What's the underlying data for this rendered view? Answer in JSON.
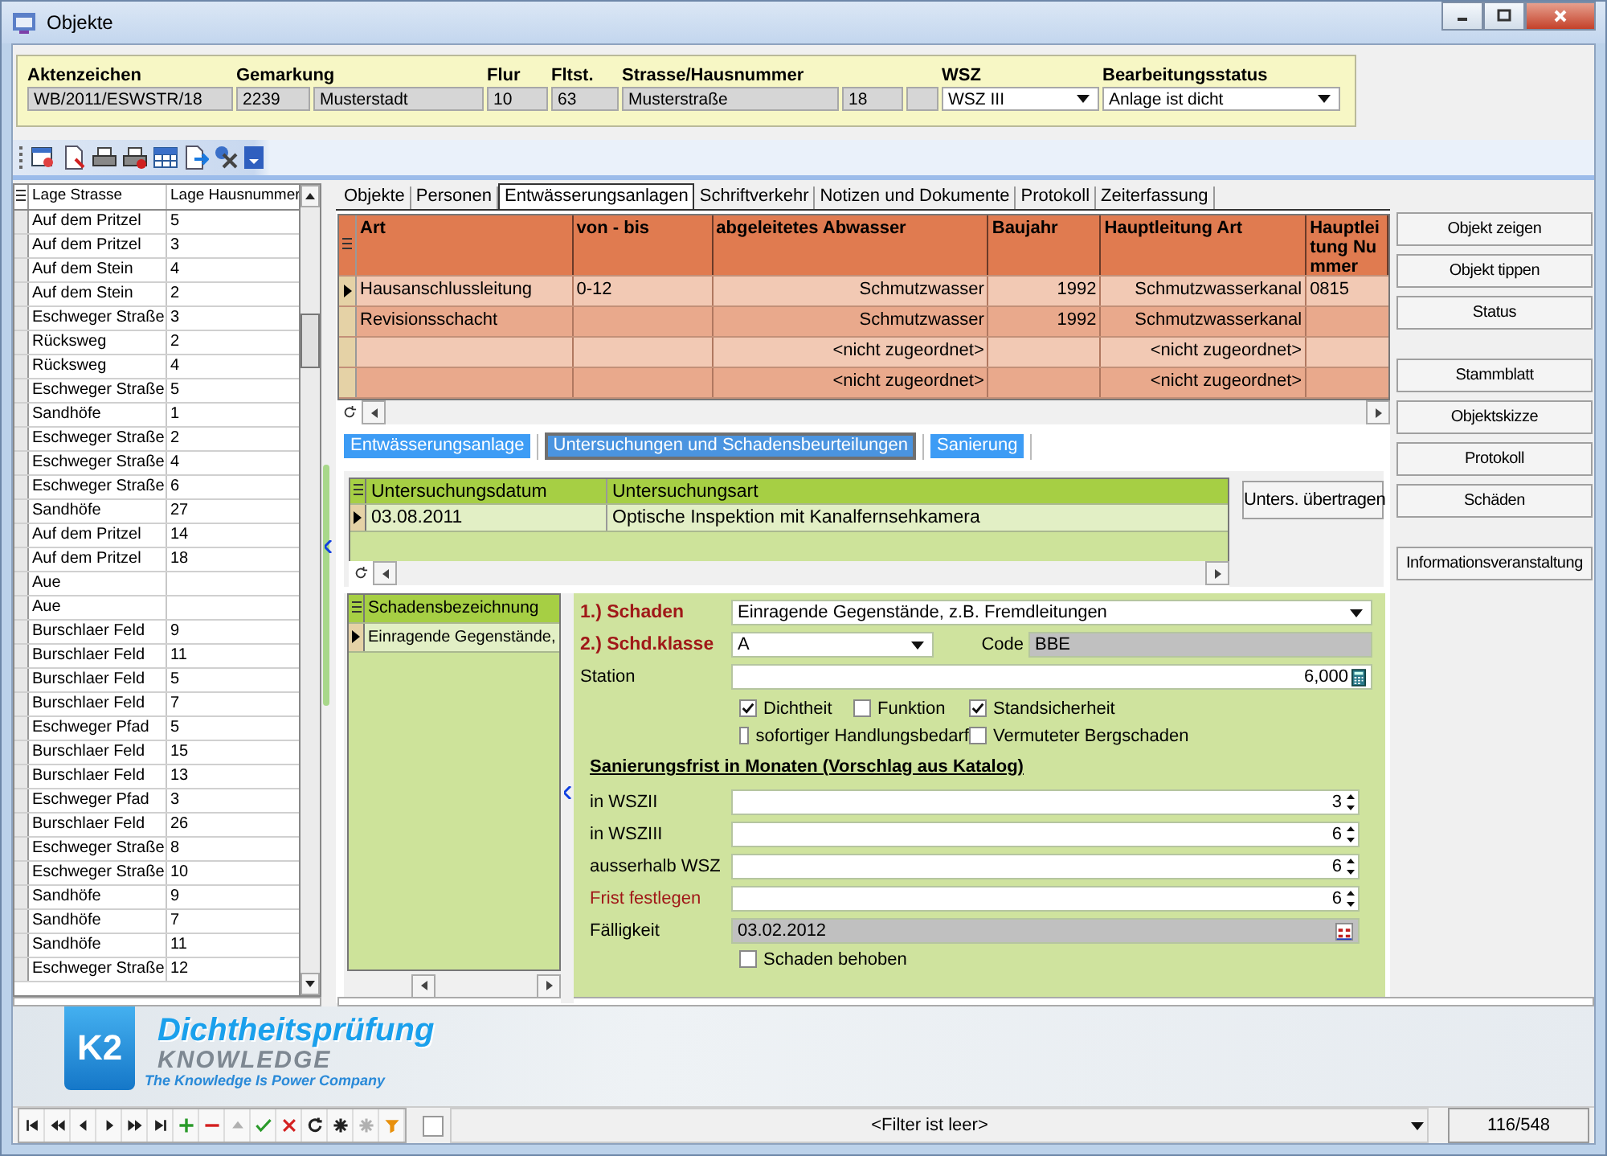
{
  "window": {
    "title": "Objekte"
  },
  "header": {
    "groups": [
      {
        "label": "Aktenzeichen",
        "fields": [
          {
            "kind": "text",
            "value": "WB/2011/ESWSTR/18"
          }
        ]
      },
      {
        "label": "Gemarkung",
        "fields": [
          {
            "kind": "text",
            "value": "2239"
          },
          {
            "kind": "text",
            "value": "Musterstadt"
          }
        ]
      },
      {
        "label": "Flur",
        "fields": [
          {
            "kind": "text",
            "value": "10"
          }
        ]
      },
      {
        "label": "Fltst.",
        "fields": [
          {
            "kind": "text",
            "value": "63"
          }
        ]
      },
      {
        "label": "Strasse/Hausnummer",
        "fields": [
          {
            "kind": "text",
            "value": "Musterstraße"
          },
          {
            "kind": "text",
            "value": "18"
          },
          {
            "kind": "text"
          }
        ]
      },
      {
        "label": "WSZ",
        "fields": [
          {
            "kind": "select",
            "value": "WSZ III"
          }
        ]
      },
      {
        "label": "Bearbeitungsstatus",
        "fields": [
          {
            "kind": "select",
            "value": "Anlage ist dicht"
          }
        ]
      }
    ]
  },
  "object_list": {
    "columns": [
      "Lage Strasse",
      "Lage Hausnummer"
    ],
    "rows": [
      {
        "street": "Auf dem Pritzel",
        "number": "5"
      },
      {
        "street": "Auf dem Pritzel",
        "number": "3"
      },
      {
        "street": "Auf dem Stein",
        "number": "4"
      },
      {
        "street": "Auf dem Stein",
        "number": "2"
      },
      {
        "street": "Eschweger Straße",
        "number": "3"
      },
      {
        "street": "Rücksweg",
        "number": "2"
      },
      {
        "street": "Rücksweg",
        "number": "4"
      },
      {
        "street": "Eschweger Straße",
        "number": "5"
      },
      {
        "street": "Sandhöfe",
        "number": "1"
      },
      {
        "street": "Eschweger Straße",
        "number": "2"
      },
      {
        "street": "Eschweger Straße",
        "number": "4"
      },
      {
        "street": "Eschweger Straße",
        "number": "6"
      },
      {
        "street": "Sandhöfe",
        "number": "27"
      },
      {
        "street": "Auf dem Pritzel",
        "number": "14"
      },
      {
        "street": "Auf dem Pritzel",
        "number": "18"
      },
      {
        "street": "Aue"
      },
      {
        "street": "Aue"
      },
      {
        "street": "Burschlaer Feld",
        "number": "9"
      },
      {
        "street": "Burschlaer Feld",
        "number": "11"
      },
      {
        "street": "Burschlaer Feld",
        "number": "5"
      },
      {
        "street": "Burschlaer Feld",
        "number": "7"
      },
      {
        "street": "Eschweger Pfad",
        "number": "5"
      },
      {
        "street": "Burschlaer Feld",
        "number": "15"
      },
      {
        "street": "Burschlaer Feld",
        "number": "13"
      },
      {
        "street": "Eschweger Pfad",
        "number": "3"
      },
      {
        "street": "Burschlaer Feld",
        "number": "26"
      },
      {
        "street": "Eschweger Straße",
        "number": "8"
      },
      {
        "street": "Eschweger Straße",
        "number": "10"
      },
      {
        "street": "Sandhöfe",
        "number": "9"
      },
      {
        "street": "Sandhöfe",
        "number": "7"
      },
      {
        "street": "Sandhöfe",
        "number": "11"
      },
      {
        "street": "Eschweger Straße",
        "number": "12"
      }
    ]
  },
  "tabs": [
    {
      "label": "Objekte",
      "selected": false
    },
    {
      "label": "Personen",
      "selected": false
    },
    {
      "label": "Entwässerungsanlagen",
      "selected": true
    },
    {
      "label": "Schriftverkehr",
      "selected": false
    },
    {
      "label": "Notizen und Dokumente",
      "selected": false
    },
    {
      "label": "Protokoll",
      "selected": false
    },
    {
      "label": "Zeiterfassung",
      "selected": false
    }
  ],
  "installations": {
    "columns": [
      "Art",
      "von - bis",
      "abgeleitetes Abwasser",
      "Baujahr",
      "Hauptleitung Art",
      "Hauptleitung Nummer"
    ],
    "rows": [
      {
        "selected": true,
        "art": "Hausanschlussleitung",
        "range": "0-12",
        "wastewater": "Schmutzwasser",
        "year": "1992",
        "main_type": "Schmutzwasserkanal",
        "main_number": "0815"
      },
      {
        "selected": false,
        "art": "Revisionsschacht",
        "wastewater": "Schmutzwasser",
        "year": "1992",
        "main_type": "Schmutzwasserkanal"
      },
      {
        "selected": false,
        "wastewater": "<nicht zugeordnet>",
        "main_type": "<nicht zugeordnet>"
      },
      {
        "selected": false,
        "wastewater": "<nicht zugeordnet>",
        "main_type": "<nicht zugeordnet>"
      }
    ]
  },
  "sub_tabs": [
    {
      "label": "Entwässerungsanlage",
      "selected": false
    },
    {
      "label": "Untersuchungen und Schadensbeurteilungen",
      "selected": true
    },
    {
      "label": "Sanierung",
      "selected": false
    }
  ],
  "inspections": {
    "columns": [
      "Untersuchungsdatum",
      "Untersuchungsart"
    ],
    "rows": [
      {
        "selected": true,
        "date": "03.08.2011",
        "type": "Optische Inspektion mit Kanalfernsehkamera"
      }
    ],
    "button": "Unters. übertragen"
  },
  "damages": {
    "column": "Schadensbezeichnung",
    "rows": [
      {
        "selected": true,
        "name": "Einragende Gegenstände,"
      }
    ]
  },
  "damage_form": {
    "damage": {
      "label": "1.) Schaden",
      "value": "Einragende Gegenstände, z.B. Fremdleitungen"
    },
    "class": {
      "label": "2.) Schd.klasse",
      "value": "A"
    },
    "code": {
      "label": "Code",
      "value": "BBE"
    },
    "station": {
      "label": "Station",
      "value": "6,000"
    },
    "checkboxes": [
      {
        "label": "Dichtheit",
        "checked": true
      },
      {
        "label": "Funktion",
        "checked": false
      },
      {
        "label": "Standsicherheit",
        "checked": true
      },
      {
        "label": "sofortiger Handlungsbedarf",
        "checked": false
      },
      {
        "label": "Vermuteter Bergschaden",
        "checked": false
      }
    ],
    "deadline_title": "Sanierungsfrist in Monaten (Vorschlag aus Katalog)",
    "deadlines": [
      {
        "kind": "catalog",
        "label": "in WSZII",
        "value": "3"
      },
      {
        "kind": "catalog",
        "label": "in WSZIII",
        "value": "6"
      },
      {
        "kind": "catalog",
        "label": "ausserhalb WSZ",
        "value": "6"
      },
      {
        "kind": "manual",
        "label": "Frist festlegen",
        "value": "6"
      }
    ],
    "due": {
      "label": "Fälligkeit",
      "value": "03.02.2012"
    },
    "fixed": {
      "label": "Schaden behoben",
      "checked": false
    }
  },
  "side_buttons": [
    [
      "Objekt zeigen",
      "Objekt tippen",
      "Status"
    ],
    [
      "Stammblatt",
      "Objektskizze",
      "Protokoll",
      "Schäden"
    ],
    [
      "Informationsveranstaltung"
    ]
  ],
  "logo": {
    "mark": "K2",
    "title": "Dichtheitsprüfung",
    "brand": "KNOWLEDGE",
    "slogan": "The Knowledge Is Power Company"
  },
  "navigator": {
    "buttons": [
      {
        "kind": "first",
        "disabled": false
      },
      {
        "kind": "prev_page",
        "disabled": false
      },
      {
        "kind": "prev",
        "disabled": false
      },
      {
        "kind": "next",
        "disabled": false
      },
      {
        "kind": "next_page",
        "disabled": false
      },
      {
        "kind": "last",
        "disabled": false
      },
      {
        "kind": "add",
        "disabled": false
      },
      {
        "kind": "delete",
        "disabled": false
      },
      {
        "kind": "up",
        "disabled": true
      },
      {
        "kind": "save",
        "disabled": false
      },
      {
        "kind": "cancel",
        "disabled": false
      },
      {
        "kind": "refresh",
        "disabled": false
      },
      {
        "kind": "star",
        "disabled": false
      },
      {
        "kind": "star",
        "disabled": true
      },
      {
        "kind": "filter",
        "disabled": false
      }
    ],
    "checked": false,
    "filter": "<Filter ist leer>",
    "position": "116/548"
  }
}
